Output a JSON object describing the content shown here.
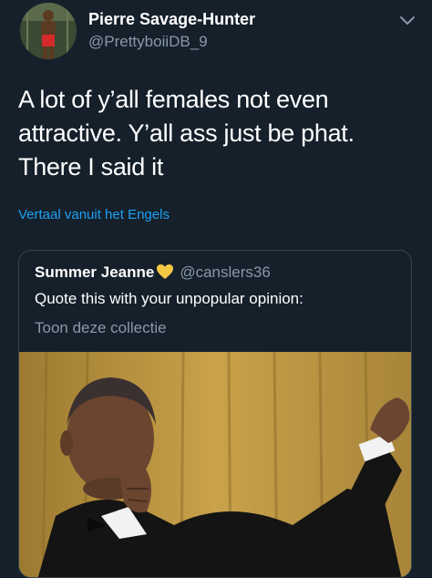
{
  "tweet": {
    "author": {
      "display_name": "Pierre Savage-Hunter",
      "handle": "@PrettyboiiDB_9",
      "avatar_icon": "profile-photo"
    },
    "menu_icon": "chevron-down-icon",
    "text": "A lot of y’all females not even attractive. Y’all ass just be phat. There I said it",
    "translate_label": "Vertaal vanuit het Engels"
  },
  "quoted_tweet": {
    "author": {
      "display_name": "Summer Jeanne",
      "emoji": "yellow-heart",
      "handle": "@canslers36"
    },
    "text": "Quote this with your unpopular opinion:",
    "collection_label": "Toon deze collectie",
    "media": "gif-mic-drop"
  },
  "colors": {
    "background": "#15202b",
    "text": "#ffffff",
    "secondary_text": "#8899a6",
    "link": "#1da1f2",
    "border": "#38444d",
    "heart": "#f7c843"
  }
}
